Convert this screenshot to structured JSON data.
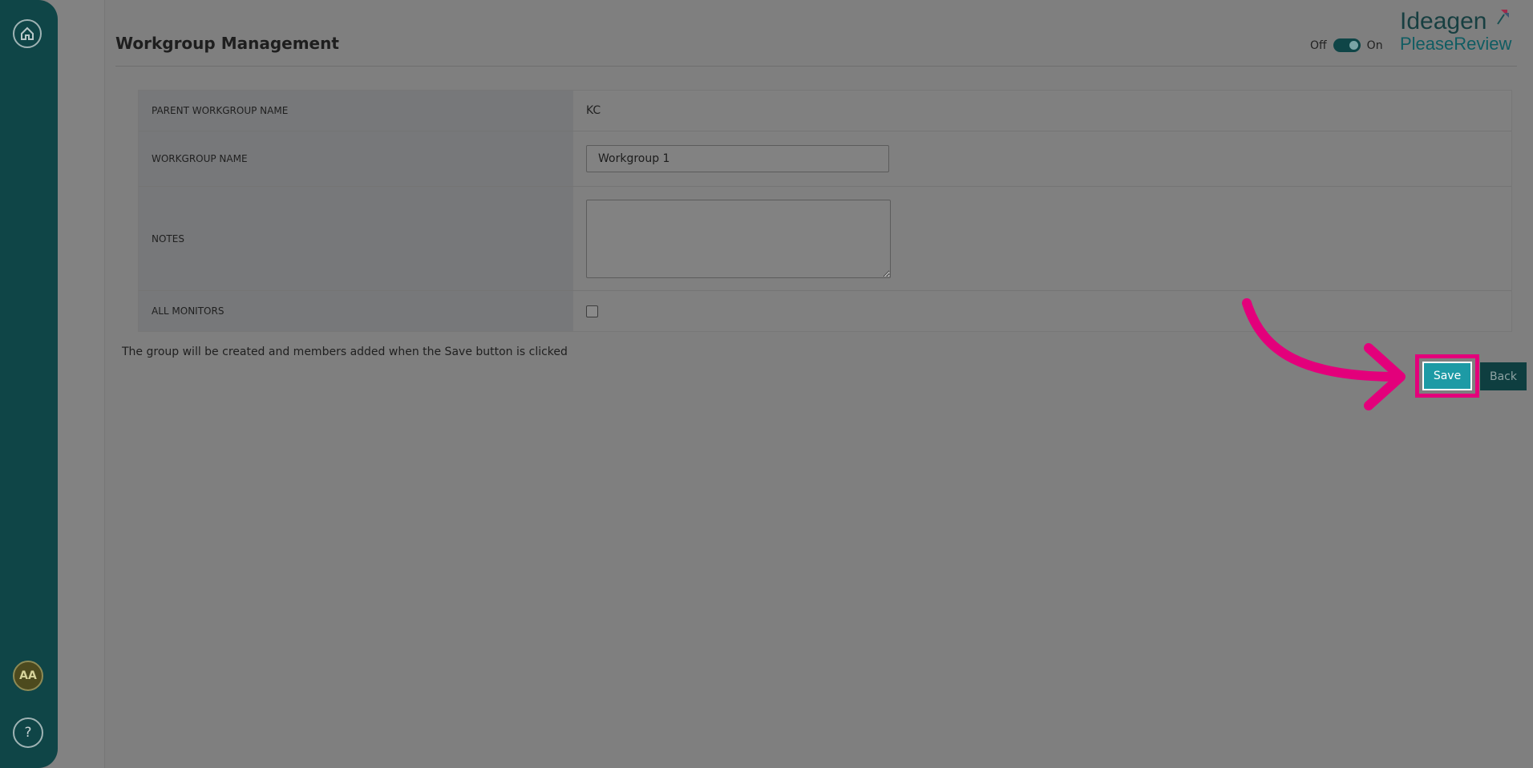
{
  "header": {
    "title": "Workgroup Management",
    "toggle_off": "Off",
    "toggle_on": "On",
    "brand_line1": "Ideagen",
    "brand_line2": "PleaseReview"
  },
  "rail": {
    "avatar_initials": "AA",
    "help_glyph": "?"
  },
  "sidebar": {
    "icons": [
      "logo-icon",
      "search-icon",
      "home-icon",
      "users-icon",
      "sliders-icon",
      "signal-icon",
      "pencil-icon",
      "list-icon",
      "help-circle-icon",
      "expand-icon"
    ]
  },
  "form": {
    "parent_label": "PARENT WORKGROUP NAME",
    "parent_value": "KC",
    "name_label": "WORKGROUP NAME",
    "name_value": "Workgroup 1",
    "notes_label": "NOTES",
    "notes_value": "",
    "monitors_label": "ALL MONITORS"
  },
  "info": "The group will be created and members added when the Save button is clicked",
  "actions": {
    "save_label": "Save",
    "back_label": "Back"
  },
  "colors": {
    "rail": "#0f4547",
    "save": "#1d9aa5",
    "back": "#0e3e40",
    "highlight": "#e3007b"
  }
}
